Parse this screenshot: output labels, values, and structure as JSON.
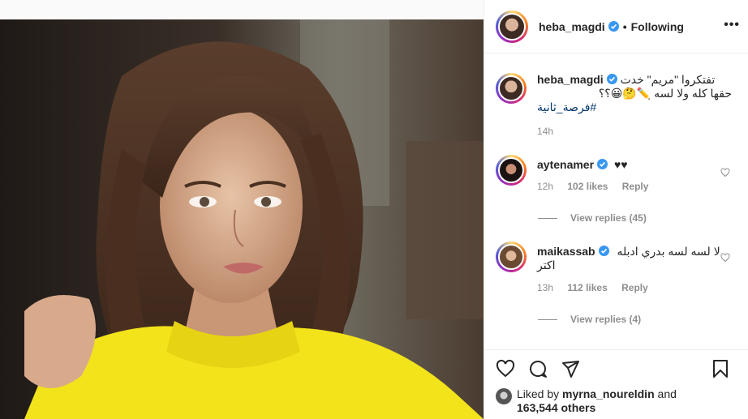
{
  "post": {
    "author": "heba_magdi",
    "follow_status": "Following",
    "more_label": "•••",
    "photo_alt": "Woman in yellow sweater looking sideways"
  },
  "caption": {
    "username": "heba_magdi",
    "line1": "تفتكروا \"مريم\" خدت",
    "line2": "حقها كله ولا لسه",
    "emoji": "✏️🤔😀؟؟",
    "hashtag": "#فرصة_ثانية",
    "time": "14h"
  },
  "comments": [
    {
      "username": "aytenamer",
      "text": "♥♥",
      "time": "12h",
      "likes": "102 likes",
      "reply_label": "Reply",
      "view_replies": "View replies (45)"
    },
    {
      "username": "maikassab",
      "text_line1": "لا لسه لسه بدري ادبله",
      "text_line2": "اكتر",
      "time": "13h",
      "likes": "112 likes",
      "reply_label": "Reply",
      "view_replies": "View replies (4)"
    }
  ],
  "likes_bar": {
    "prefix": "Liked by",
    "user": "myrna_noureldin",
    "and": "and",
    "count": "163,544 others"
  },
  "icons": [
    "heart-icon",
    "comment-icon",
    "share-icon",
    "bookmark-icon",
    "verified-icon",
    "more-icon"
  ],
  "colors": {
    "verified": "#3897f0",
    "link": "#00376b",
    "muted": "#8e8e8e",
    "sweater": "#f2e31a"
  }
}
